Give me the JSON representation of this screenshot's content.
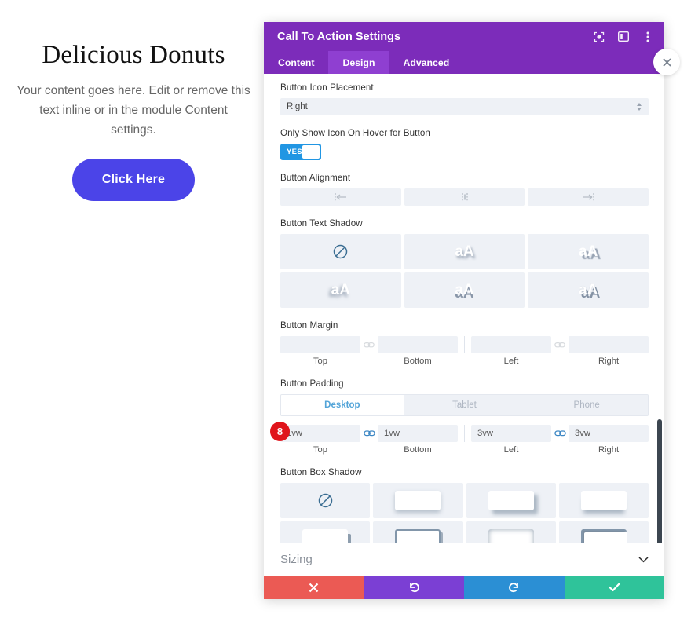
{
  "preview": {
    "title": "Delicious Donuts",
    "body": "Your content goes here. Edit or remove this text inline or in the module Content settings.",
    "button_label": "Click Here",
    "button_color": "#4b44e8"
  },
  "panel": {
    "title": "Call To Action Settings",
    "header_color": "#7c2cba",
    "header_icons": [
      {
        "name": "focus-icon"
      },
      {
        "name": "layout-icon"
      },
      {
        "name": "more-vertical-icon"
      }
    ],
    "tabs": [
      {
        "label": "Content",
        "active": false
      },
      {
        "label": "Design",
        "active": true
      },
      {
        "label": "Advanced",
        "active": false
      }
    ],
    "close_button": "close-icon"
  },
  "fields": {
    "icon_placement": {
      "label": "Button Icon Placement",
      "value": "Right"
    },
    "hover_icon": {
      "label": "Only Show Icon On Hover for Button",
      "toggle_value": "YES",
      "toggle_color": "#2196e3"
    },
    "alignment": {
      "label": "Button Alignment",
      "options": [
        "align-left-icon",
        "align-center-icon",
        "align-right-icon"
      ]
    },
    "text_shadow": {
      "label": "Button Text Shadow",
      "presets": [
        {
          "name": "none-preset",
          "sample": ""
        },
        {
          "name": "text-shadow-1",
          "sample": "aA"
        },
        {
          "name": "text-shadow-2",
          "sample": "aA"
        },
        {
          "name": "text-shadow-3",
          "sample": "aA"
        },
        {
          "name": "text-shadow-4",
          "sample": "aA"
        },
        {
          "name": "text-shadow-5",
          "sample": "aA"
        }
      ]
    },
    "margin": {
      "label": "Button Margin",
      "values": {
        "top": "",
        "bottom": "",
        "left": "",
        "right": ""
      },
      "labels": {
        "top": "Top",
        "bottom": "Bottom",
        "left": "Left",
        "right": "Right"
      },
      "link_icon": "link-icon"
    },
    "padding": {
      "label": "Button Padding",
      "devices": [
        {
          "label": "Desktop",
          "active": true
        },
        {
          "label": "Tablet",
          "active": false
        },
        {
          "label": "Phone",
          "active": false
        }
      ],
      "values": {
        "top": "1vw",
        "bottom": "1vw",
        "left": "3vw",
        "right": "3vw"
      },
      "labels": {
        "top": "Top",
        "bottom": "Bottom",
        "left": "Left",
        "right": "Right"
      },
      "link_icon": "link-icon",
      "badge": "8",
      "badge_color": "#e0141b"
    },
    "box_shadow": {
      "label": "Button Box Shadow",
      "presets": [
        {
          "name": "none-preset"
        },
        {
          "name": "box-shadow-1"
        },
        {
          "name": "box-shadow-2"
        },
        {
          "name": "box-shadow-3"
        },
        {
          "name": "box-shadow-4"
        },
        {
          "name": "box-shadow-5"
        },
        {
          "name": "box-shadow-6"
        },
        {
          "name": "box-shadow-7"
        }
      ]
    }
  },
  "sizing": {
    "label": "Sizing",
    "chevron": "chevron-down-icon"
  },
  "footer": {
    "buttons": [
      {
        "name": "cancel-button",
        "icon": "close-icon",
        "color": "#eb5a54"
      },
      {
        "name": "undo-button",
        "icon": "undo-icon",
        "color": "#7b3fd4"
      },
      {
        "name": "redo-button",
        "icon": "redo-icon",
        "color": "#2b8fd4"
      },
      {
        "name": "save-button",
        "icon": "check-icon",
        "color": "#2fc39a"
      }
    ]
  }
}
